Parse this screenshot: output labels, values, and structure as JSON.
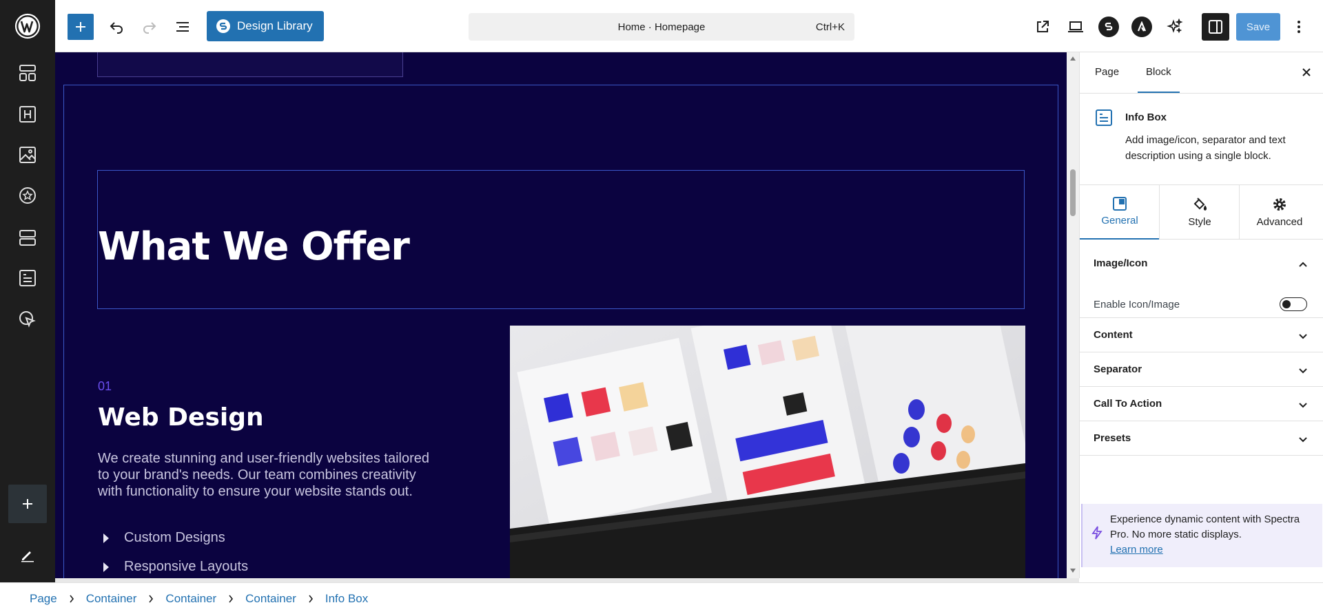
{
  "toolbar": {
    "design_library_label": "Design Library",
    "command_title": "Home · Homepage",
    "command_shortcut": "Ctrl+K",
    "save_label": "Save",
    "accent_color": "#2271b1"
  },
  "canvas": {
    "heading": "What We Offer",
    "service_number": "01",
    "service_title": "Web Design",
    "service_description": "We create stunning and user-friendly websites tailored to your brand's needs. Our team combines creativity with functionality to ensure your website stands out.",
    "bullets": [
      "Custom Designs",
      "Responsive Layouts"
    ],
    "background_color": "#0b0340"
  },
  "sidebar": {
    "tabs": [
      "Page",
      "Block"
    ],
    "active_tab": "Block",
    "block_name": "Info Box",
    "block_description": "Add image/icon, separator and text description using a single block.",
    "settings_tabs": [
      "General",
      "Style",
      "Advanced"
    ],
    "active_settings_tab": "General",
    "panels": {
      "image_icon": "Image/Icon",
      "enable_label": "Enable Icon/Image",
      "content": "Content",
      "separator": "Separator",
      "call_to_action": "Call To Action",
      "presets": "Presets"
    },
    "promo_text": "Experience dynamic content with Spectra Pro. No more static displays.",
    "promo_link": "Learn more"
  },
  "breadcrumb": [
    "Page",
    "Container",
    "Container",
    "Container",
    "Info Box"
  ],
  "icons": {
    "left_bar": [
      "wordpress-logo-icon",
      "layout-icon",
      "heading-icon",
      "image-icon",
      "star-icon",
      "container-icon",
      "info-box-icon",
      "pointer-icon",
      "add-icon",
      "edit-icon"
    ]
  }
}
